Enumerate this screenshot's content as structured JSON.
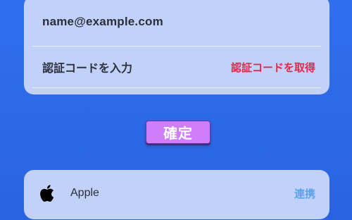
{
  "login_form": {
    "email_value": "name@example.com",
    "code_placeholder": "認証コードを入力",
    "get_code_label": "認証コードを取得"
  },
  "confirm": {
    "label": "確定"
  },
  "apple_link": {
    "provider_name": "Apple",
    "link_label": "連携",
    "icon": "apple-icon"
  },
  "colors": {
    "background": "#2f6fee",
    "card": "#c2d1f7",
    "get_code": "#e8264a",
    "confirm_button": "#d07dfb",
    "link": "#5aa4ee"
  }
}
